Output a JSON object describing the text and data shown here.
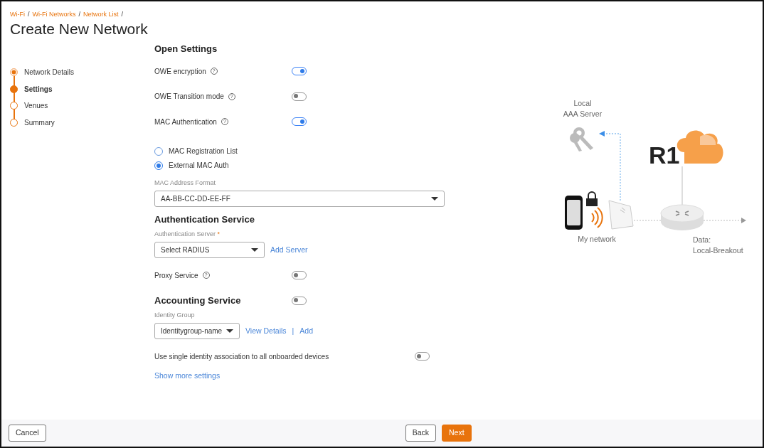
{
  "breadcrumb": [
    "Wi-Fi",
    "Wi-Fi Networks",
    "Network List"
  ],
  "breadcrumb_separator": "/",
  "title": "Create New Network",
  "steps": [
    {
      "label": "Network Details",
      "completed": true,
      "selected": false
    },
    {
      "label": "Settings",
      "completed": false,
      "selected": true
    },
    {
      "label": "Venues",
      "completed": false,
      "selected": false
    },
    {
      "label": "Summary",
      "completed": false,
      "selected": false
    }
  ],
  "open_settings": {
    "heading": "Open Settings",
    "toggles": [
      {
        "label": "OWE encryption",
        "help": "?",
        "on": true
      },
      {
        "label": "OWE Transition mode",
        "help": "?",
        "on": false
      },
      {
        "label": "MAC Authentication",
        "help": "?",
        "on": true
      }
    ]
  },
  "mac_auth_options": [
    {
      "label": "MAC Registration List",
      "selected": false
    },
    {
      "label": "External MAC Auth",
      "selected": true
    }
  ],
  "mac_address_format": {
    "label": "MAC Address Format",
    "value": "AA-BB-CC-DD-EE-FF"
  },
  "authentication_service": {
    "heading": "Authentication Service",
    "server_label": "Authentication Server",
    "required_mark": "*",
    "server_value": "Select RADIUS",
    "add_link": "Add Server",
    "proxy": {
      "label": "Proxy Service",
      "help": "?",
      "on": false
    }
  },
  "accounting_service": {
    "heading": "Accounting Service",
    "on": false
  },
  "identity_group": {
    "label": "Identity Group",
    "value": "Identitygroup-name",
    "links": [
      "View Details",
      "Add"
    ],
    "link_separator": "|"
  },
  "single_identity": {
    "label": "Use single identity association to all onboarded devices",
    "on": false
  },
  "show_more": "Show more settings",
  "diagram": {
    "aaa_label": [
      "Local",
      "AAA Server"
    ],
    "logo_text": "R1",
    "network_label": "My network",
    "data_label": [
      "Data:",
      "Local-Breakout"
    ]
  },
  "footer": {
    "cancel": "Cancel",
    "back": "Back",
    "next": "Next"
  }
}
